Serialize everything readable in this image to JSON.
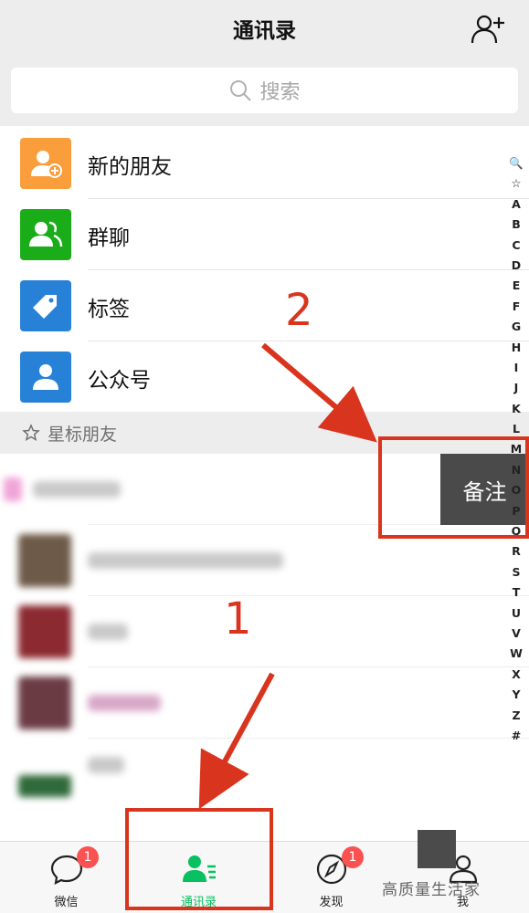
{
  "header": {
    "title": "通讯录",
    "add_icon": "add-contact-icon"
  },
  "search": {
    "placeholder": "搜索",
    "icon": "search-icon"
  },
  "features": [
    {
      "label": "新的朋友",
      "icon": "new-friends-icon",
      "color": "#fa9d3b"
    },
    {
      "label": "群聊",
      "icon": "group-chat-icon",
      "color": "#1aad19"
    },
    {
      "label": "标签",
      "icon": "tag-icon",
      "color": "#2782d7"
    },
    {
      "label": "公众号",
      "icon": "official-account-icon",
      "color": "#2782d7"
    }
  ],
  "section": {
    "label": "星标朋友",
    "icon": "star-icon"
  },
  "contacts_note": "Contact names and avatars are blurred in the screenshot",
  "swipe_action": {
    "label": "备注"
  },
  "index": [
    "🔍",
    "☆",
    "A",
    "B",
    "C",
    "D",
    "E",
    "F",
    "G",
    "H",
    "I",
    "J",
    "K",
    "L",
    "M",
    "N",
    "O",
    "P",
    "Q",
    "R",
    "S",
    "T",
    "U",
    "V",
    "W",
    "X",
    "Y",
    "Z",
    "#"
  ],
  "tabs": [
    {
      "label": "微信",
      "icon": "chat-icon",
      "badge": "1"
    },
    {
      "label": "通讯录",
      "icon": "contacts-icon",
      "active": true
    },
    {
      "label": "发现",
      "icon": "discover-icon",
      "badge": "1"
    },
    {
      "label": "我",
      "icon": "me-icon"
    }
  ],
  "annotations": {
    "step1": "1",
    "step2": "2",
    "color": "#d9341e"
  },
  "watermark": "高质量生活家",
  "colors": {
    "accent": "#07c160",
    "badge": "#fa5151",
    "annotation": "#d9341e"
  }
}
